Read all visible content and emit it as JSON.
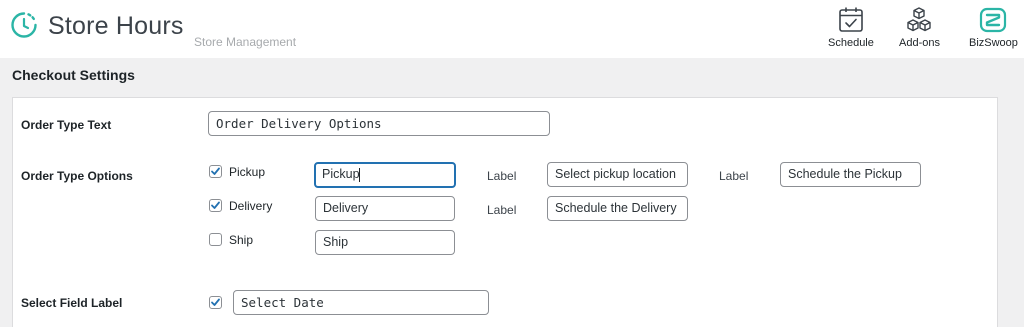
{
  "header": {
    "title": "Store Hours",
    "subtitle": "Store Management",
    "nav": [
      {
        "label": "Schedule",
        "icon": "calendar-check-icon"
      },
      {
        "label": "Add-ons",
        "icon": "cubes-icon"
      },
      {
        "label": "BizSwoop",
        "icon": "bizswoop-logo-icon"
      }
    ],
    "accent_color": "#2bb5a6"
  },
  "section": {
    "title": "Checkout Settings"
  },
  "order_type_text": {
    "label": "Order Type Text",
    "value": "Order Delivery Options"
  },
  "order_type_options": {
    "label": "Order Type Options",
    "options": [
      {
        "name": "Pickup",
        "checked": true,
        "value": "Pickup",
        "label1": "Label",
        "value1": "Select pickup location",
        "label2": "Label",
        "value2": "Schedule the Pickup"
      },
      {
        "name": "Delivery",
        "checked": true,
        "value": "Delivery",
        "label1": "Label",
        "value1": "Schedule the Delivery"
      },
      {
        "name": "Ship",
        "checked": false,
        "value": "Ship"
      }
    ]
  },
  "select_field_label": {
    "label": "Select Field Label",
    "checked": true,
    "value": "Select Date"
  }
}
